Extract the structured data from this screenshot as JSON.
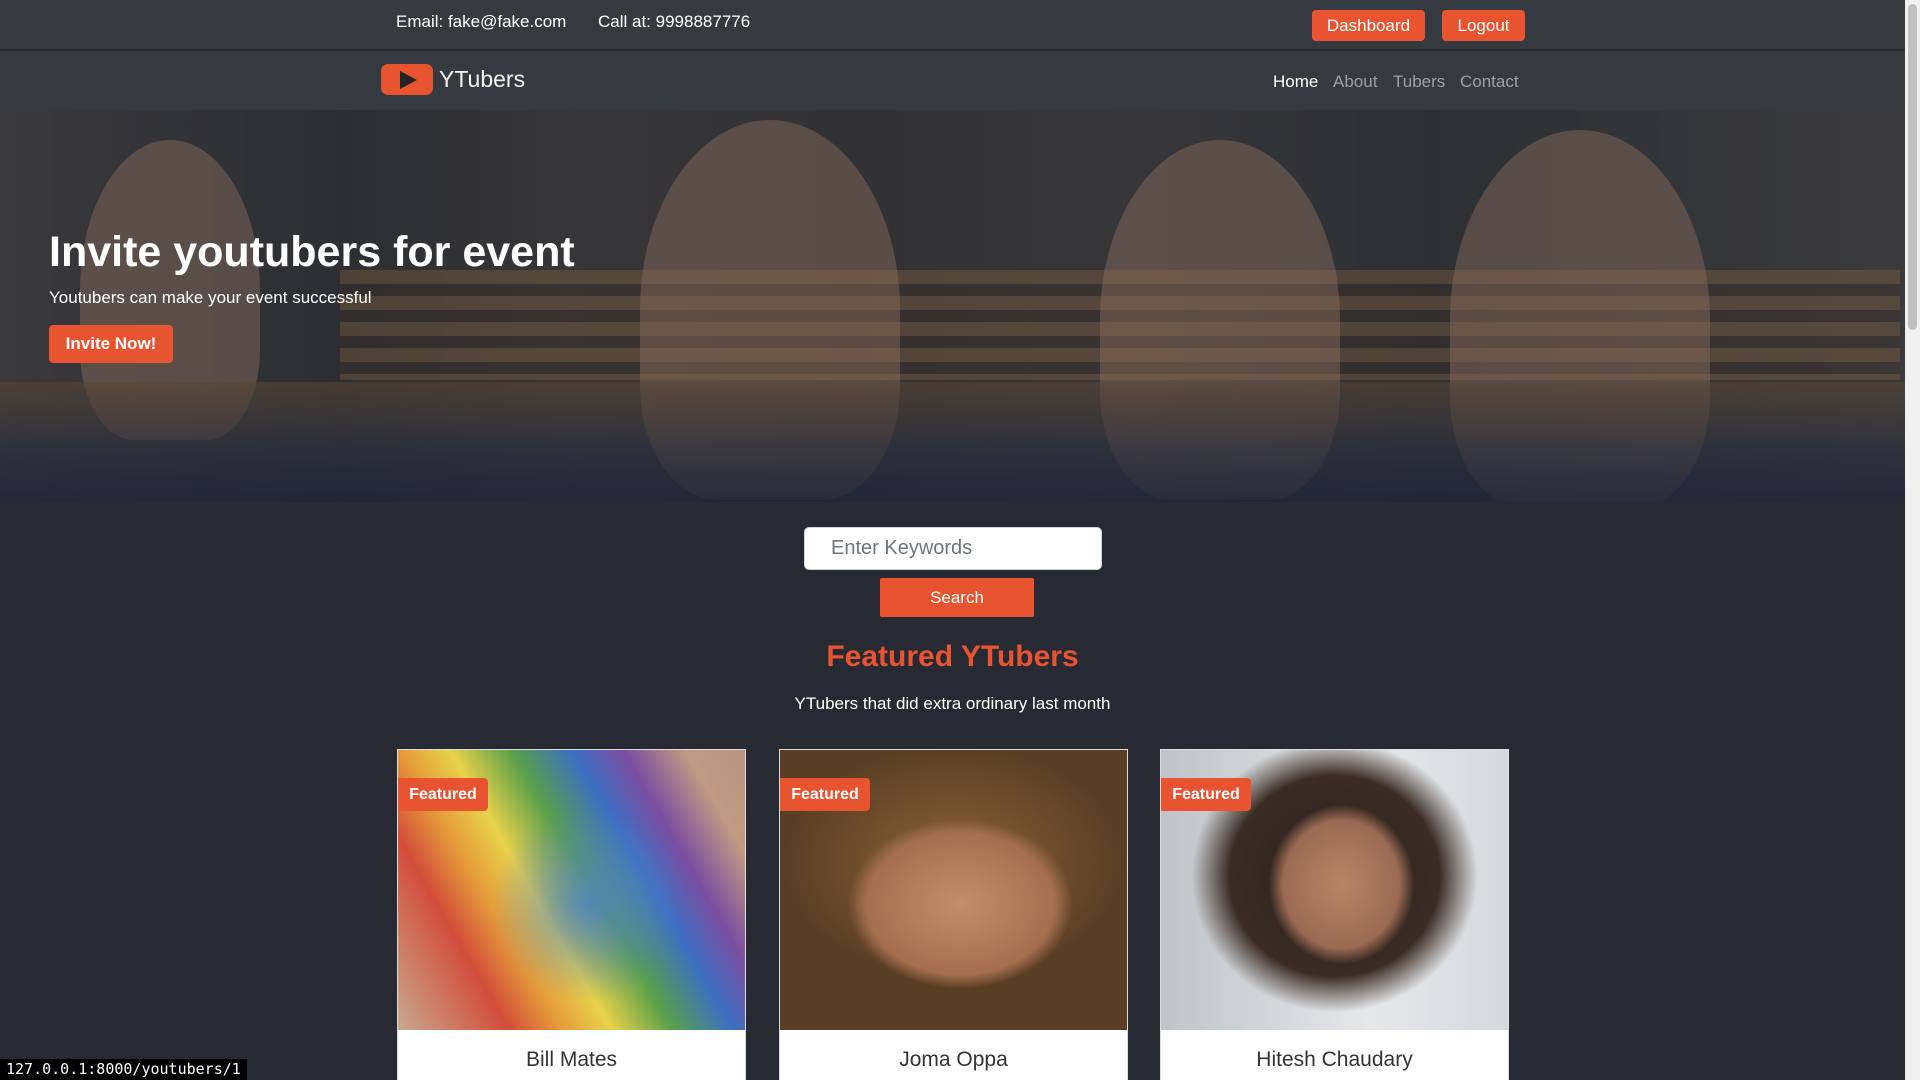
{
  "topbar": {
    "email": "Email: fake@fake.com",
    "phone": "Call at: 9998887776",
    "dashboard_label": "Dashboard",
    "logout_label": "Logout"
  },
  "navbar": {
    "brand": "YTubers",
    "brand_icon": "play-icon",
    "links": [
      "Home",
      "About",
      "Tubers",
      "Contact"
    ],
    "active": "Home"
  },
  "hero": {
    "title": "Invite youtubers for event",
    "subtitle": "Youtubers can make your event successful",
    "cta_label": "Invite Now!"
  },
  "search": {
    "placeholder": "Enter Keywords",
    "button_label": "Search"
  },
  "featured": {
    "title": "Featured YTubers",
    "subtitle": "YTubers that did extra ordinary last month",
    "cards": [
      {
        "badge": "Featured",
        "name": "Bill Mates"
      },
      {
        "badge": "Featured",
        "name": "Joma Oppa"
      },
      {
        "badge": "Featured",
        "name": "Hitesh Chaudary"
      }
    ]
  },
  "status_bar": {
    "url": "127.0.0.1:8000/youtubers/1"
  },
  "colors": {
    "accent": "#e8542f",
    "background": "#272a33",
    "navbar": "#343a40"
  }
}
